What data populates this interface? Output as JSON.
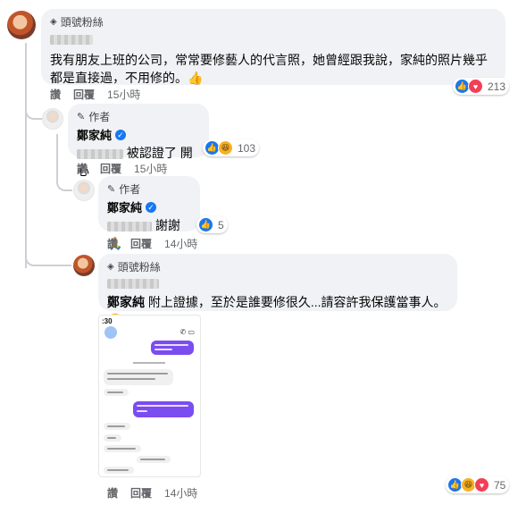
{
  "comment1": {
    "badge": "頭號粉絲",
    "text": "我有朋友上班的公司，常常要修藝人的代言照，她曾經跟我說，家純的照片幾乎都是直接過，不用修的。",
    "emoji": "👍",
    "actions": {
      "like": "讚",
      "reply": "回覆",
      "time": "15小時"
    },
    "reaction_count": "213"
  },
  "reply1": {
    "badge": "作者",
    "name": "鄭家純",
    "text": "被認證了 開心",
    "actions": {
      "like": "讚",
      "reply": "回覆",
      "time": "15小時"
    },
    "reaction_count": "103"
  },
  "reply2": {
    "badge": "作者",
    "name": "鄭家純",
    "text": "謝謝",
    "emoji": "🙏",
    "actions": {
      "like": "讚",
      "reply": "回覆",
      "time": "14小時"
    },
    "reaction_count": "5"
  },
  "reply3": {
    "badge": "頭號粉絲",
    "mention": "鄭家純",
    "text": " 附上證據，至於是誰要修很久...請容許我保護當事人。",
    "emoji": "🤣",
    "actions": {
      "like": "讚",
      "reply": "回覆",
      "time": "14小時"
    },
    "reaction_count": "75",
    "phone_status": ":30"
  },
  "icons": {
    "badge": "diamond-icon",
    "author": "pencil-icon",
    "verified": "verified-check-icon",
    "like": "like-icon",
    "love": "love-icon",
    "haha": "haha-icon"
  },
  "colors": {
    "like": "#1877f2",
    "love": "#f33e58",
    "haha": "#f7b125",
    "bubble": "#f0f2f5",
    "purple": "#7b4cf0"
  }
}
